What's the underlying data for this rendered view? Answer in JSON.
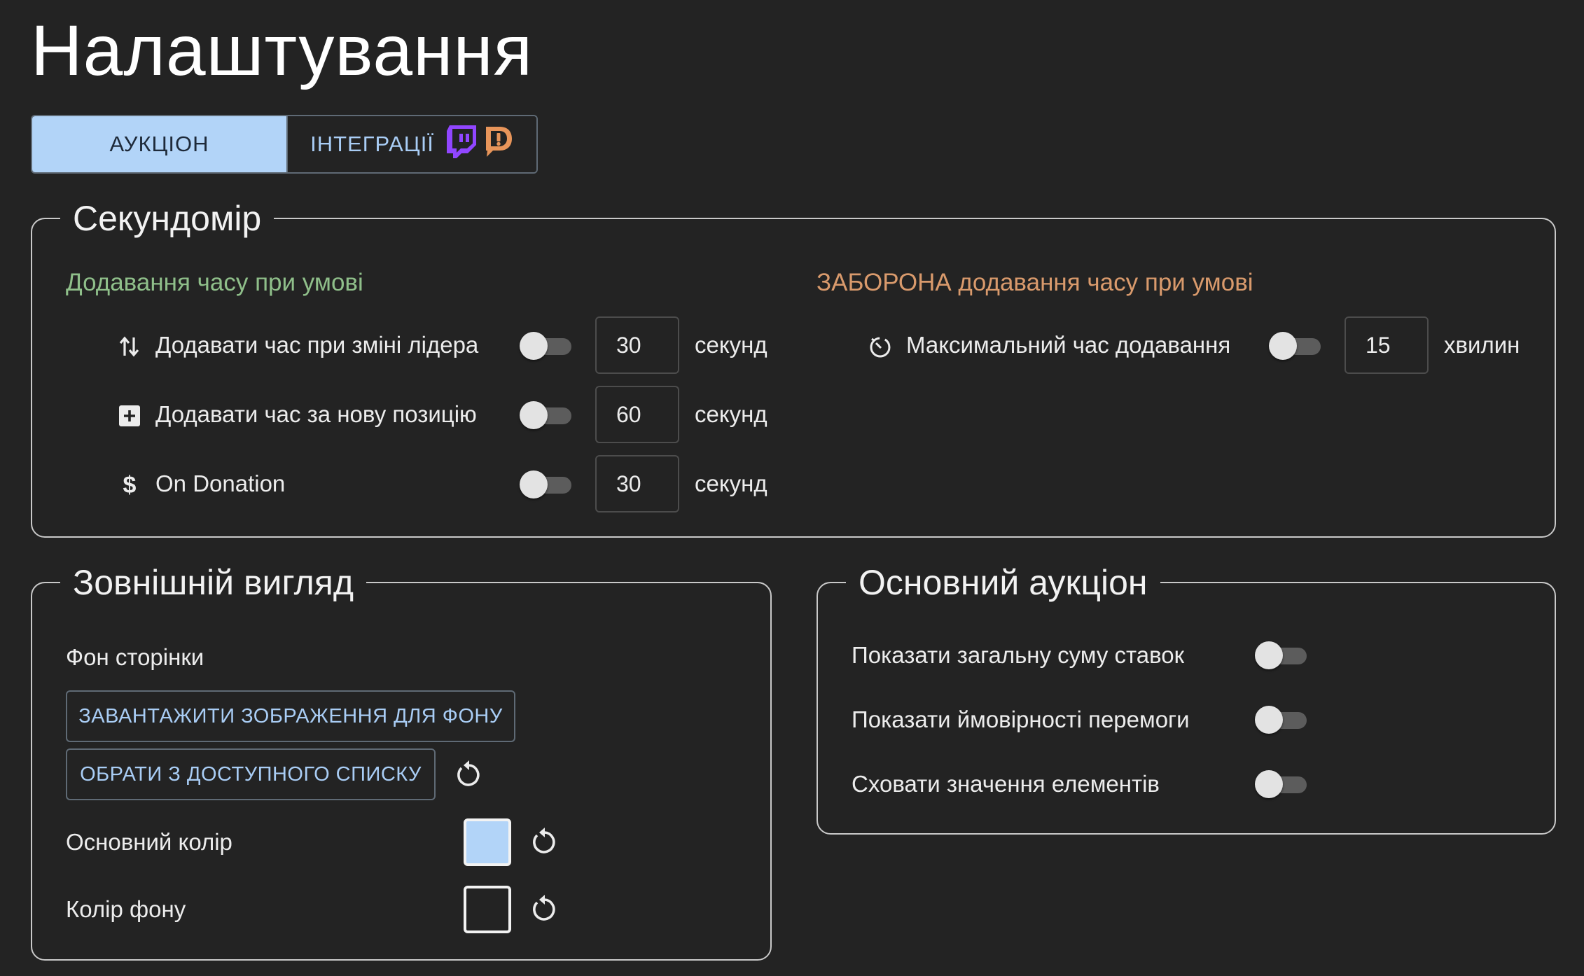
{
  "page": {
    "title": "Налаштування"
  },
  "tabs": [
    {
      "label": "АУКЦІОН",
      "active": true
    },
    {
      "label": "ІНТЕГРАЦІЇ",
      "active": false,
      "icons": [
        "twitch-icon",
        "donationalerts-icon"
      ]
    }
  ],
  "colors": {
    "accent": "#b2d4f8",
    "positive": "#8fbf8a",
    "negative": "#d99a6c",
    "twitch": "#9146ff",
    "donation": "#e8955a"
  },
  "stopwatch": {
    "title": "Секундомір",
    "add_heading": "Додавання часу при умові",
    "ban_heading": "ЗАБОРОНА додавання часу при умові",
    "add_rows": [
      {
        "icon": "swap-arrows-icon",
        "label": "Додавати час при зміні лідера",
        "enabled": false,
        "value": "30",
        "unit": "секунд"
      },
      {
        "icon": "plus-box-icon",
        "label": "Додавати час за нову позицію",
        "enabled": false,
        "value": "60",
        "unit": "секунд"
      },
      {
        "icon": "dollar-icon",
        "label": "On Donation",
        "enabled": false,
        "value": "30",
        "unit": "секунд"
      }
    ],
    "ban_rows": [
      {
        "icon": "timer-off-icon",
        "label": "Максимальний час додавання",
        "enabled": false,
        "value": "15",
        "unit": "хвилин"
      }
    ]
  },
  "appearance": {
    "title": "Зовнішній вигляд",
    "background_label": "Фон сторінки",
    "upload_button": "ЗАВАНТАЖИТИ ЗОБРАЖЕННЯ ДЛЯ ФОНУ",
    "choose_button": "ОБРАТИ З ДОСТУПНОГО СПИСКУ",
    "primary_color_label": "Основний колір",
    "primary_color": "#b2d4f8",
    "bg_color_label": "Колір фону",
    "bg_color": "#232323"
  },
  "main_auction": {
    "title": "Основний аукціон",
    "rows": [
      {
        "label": "Показати загальну суму ставок",
        "enabled": false
      },
      {
        "label": "Показати ймовірності перемоги",
        "enabled": false
      },
      {
        "label": "Сховати значення елементів",
        "enabled": false
      }
    ]
  }
}
